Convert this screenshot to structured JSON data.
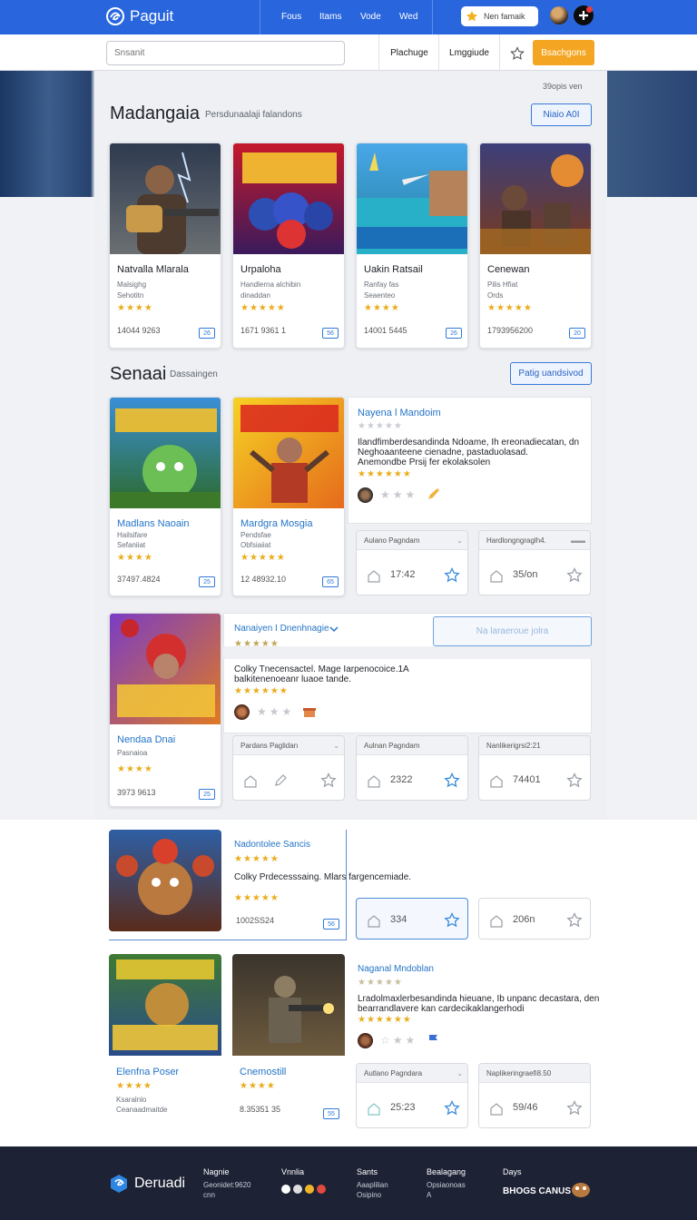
{
  "topbar": {
    "brand": "Paguit",
    "nav": [
      "Fous",
      "Itams",
      "Vode",
      "Wed"
    ],
    "search_label": "Nen famaik",
    "notif_glyph": "⚫"
  },
  "subbar": {
    "search_placeholder": "Snsanit",
    "btn1": "Plachuge",
    "btn2": "Lmggiude",
    "cta": "Bsachgons"
  },
  "featured": {
    "corner_text": "39opis ven",
    "title": "Madangaia",
    "subtitle": "Persdunaalaji falandons",
    "button": "Niaio A0I",
    "cards": [
      {
        "title": "Natvalla Mlarala",
        "l1": "Malsighg",
        "l2": "Sehotitn",
        "stars": "★★★★",
        "price": "14044 9263",
        "badge": "26"
      },
      {
        "title": "Urpaloha",
        "l1": "Handlerna alchibin",
        "l2": "dinaddan",
        "stars": "★★★★★",
        "price": "1671 9361 1",
        "badge": "56"
      },
      {
        "title": "Uakin Ratsail",
        "l1": "Ranfay fas",
        "l2": "Seaenteo",
        "stars": "★★★★",
        "price": "14001 5445",
        "badge": "26"
      },
      {
        "title": "Cenewan",
        "l1": "Pilis Hfiat",
        "l2": "Ords",
        "stars": "★★★★★",
        "price": "1793956200",
        "badge": "20"
      }
    ]
  },
  "section2": {
    "title": "Senaai",
    "subtitle": "Dassaingen",
    "button": "Patig uandsivod"
  },
  "row1": {
    "cards": [
      {
        "title": "Madlans Naoain",
        "l1": "Hailsifare",
        "l2": "Sefaniiat",
        "stars": "★★★★",
        "price": "37497.4824",
        "badge": "25"
      },
      {
        "title": "Mardgra Mosgia",
        "l1": "Pendsfae",
        "l2": "Obfsiaiiat",
        "stars": "★★★★★",
        "price": "12 48932.10",
        "badge": "65"
      }
    ],
    "info_title": "Nayena l Mandoim",
    "info_stars": "★★★★★",
    "info_desc": [
      "Ilandfimberdesandinda Ndoame, Ih ereonadiecatan, dn",
      "Neghoaanteene cienadne, pastaduolasad.",
      "Anemondbe Prsij fer ekolaksolen"
    ],
    "info_stars2": "★★★★★★",
    "mini": [
      {
        "head": "Aulano Pagndam",
        "val": "17:42"
      },
      {
        "head": "Hardlongngraglh4.",
        "val": "35/on"
      }
    ]
  },
  "row2": {
    "card": {
      "title": "Nendaa Dnai",
      "l1": "Pasnaioa",
      "stars": "★★★★",
      "price": "3973 9613",
      "badge": "25"
    },
    "info_title": "Nanaiyen I Dnenhnagie",
    "overlay_btn": "Na laraeroue jolra",
    "info_stars": "★★★★★",
    "info_desc": [
      "Colky Tnecensactel. Mage Iarpenocoice.1A",
      "balkitenenoeanr luaoe tande."
    ],
    "info_stars2": "★★★★★★",
    "mini": [
      {
        "head": "Pardans Paglidan",
        "val": ""
      },
      {
        "head": "Aulnan Pagndam",
        "val": "2322"
      },
      {
        "head": "Nanlikerigrsi2:21",
        "val": "74401"
      }
    ]
  },
  "row3": {
    "info_title": "Nadontolee Sancis",
    "info_stars": "★★★★★",
    "info_desc": "Colky Prdecesssaing. Mlars fargencemiade.",
    "info_stars2": "★★★★★",
    "price": "1002SS24",
    "badge": "56",
    "mini": [
      {
        "val": "334"
      },
      {
        "val": "206n"
      }
    ]
  },
  "row4": {
    "cards": [
      {
        "title": "Elenfna Poser",
        "l1": "Ksaralnlo",
        "l2": "Ceanaadmaitde",
        "stars": "★★★★"
      },
      {
        "title": "Cnemostill",
        "stars": "★★★★",
        "price": "8.35351 35",
        "badge": "55"
      }
    ],
    "info_title": "Naganal Mndoblan",
    "info_stars": "★★★★★",
    "info_desc": [
      "Lradolmaxlerbesandinda hieuane, Ib unpanc decastara, den",
      "bearrandlavere kan cardecikaklangerhodi"
    ],
    "info_stars2": "★★★★★★",
    "mini": [
      {
        "head": "Autlano Pagndara",
        "val": "25:23"
      },
      {
        "head": "Naplikeringraefi8.50",
        "val": "59/46"
      }
    ]
  },
  "footer": {
    "brand": "Deruadi",
    "c1_title": "Nagnie",
    "c1_l1": "Geonidet:9620",
    "c1_l2": "cnn",
    "c2_title": "Vnnlia",
    "c3_title": "Sants",
    "c3_l1": "Aaaplilian",
    "c3_l2": "Osipino",
    "c4_title": "Bealagang",
    "c4_l1": "Opsiaonoas",
    "c4_l2": "A",
    "c5_title": "Days",
    "c5_l1": "BHOGS CANUS"
  },
  "colors": {
    "primary": "#2966dd",
    "accent": "#f4a623",
    "star": "#e9ad1b",
    "footer": "#1d2235"
  }
}
